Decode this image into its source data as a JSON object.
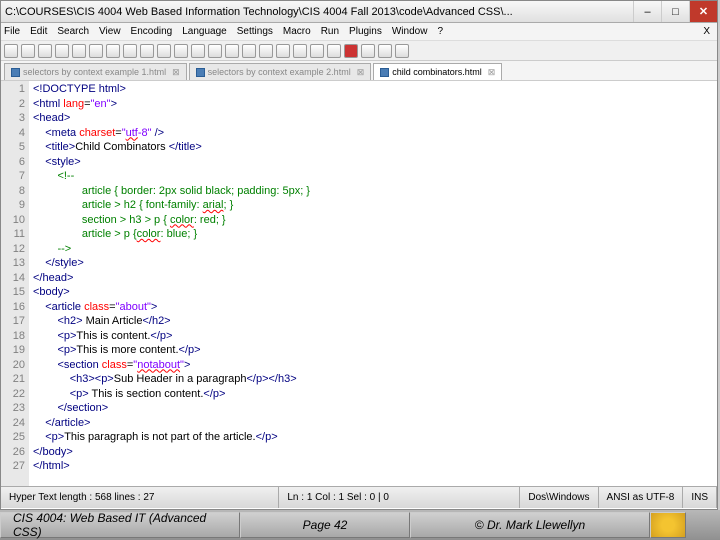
{
  "titlebar": {
    "path": "C:\\COURSES\\CIS 4004   Web Based Information Technology\\CIS 4004    Fall 2013\\code\\Advanced CSS\\..."
  },
  "menubar": [
    "File",
    "Edit",
    "Search",
    "View",
    "Encoding",
    "Language",
    "Settings",
    "Macro",
    "Run",
    "Plugins",
    "Window",
    "?"
  ],
  "tabs": [
    {
      "label": "selectors by context example 1.html",
      "active": false
    },
    {
      "label": "selectors by context example 2.html",
      "active": false
    },
    {
      "label": "child combinators.html",
      "active": true
    }
  ],
  "code": {
    "lines": [
      {
        "n": 1,
        "html": "<span class='tag'>&lt;!DOCTYPE html&gt;</span>"
      },
      {
        "n": 2,
        "html": "<span class='tag'>&lt;html</span> <span class='attr'>lang</span>=<span class='str'>\"en\"</span><span class='tag'>&gt;</span>"
      },
      {
        "n": 3,
        "html": "<span class='tag'>&lt;head&gt;</span>"
      },
      {
        "n": 4,
        "html": "    <span class='tag'>&lt;meta</span> <span class='attr'>charset</span>=<span class='str'>\"<span class='wavy'>utf</span>-8\"</span> <span class='tag'>/&gt;</span>"
      },
      {
        "n": 5,
        "html": "    <span class='tag'>&lt;title&gt;</span><span class='txt'>Child Combinators </span><span class='tag'>&lt;/title&gt;</span>"
      },
      {
        "n": 6,
        "html": "    <span class='tag'>&lt;style&gt;</span>"
      },
      {
        "n": 7,
        "html": "        <span class='com'>&lt;!--</span>"
      },
      {
        "n": 8,
        "html": "<span class='com'>                article { border: 2px solid black; padding: 5px; }</span>"
      },
      {
        "n": 9,
        "html": "<span class='com'>                article &gt; h2 { font-family: <span class='wavy'>arial</span>; }</span>"
      },
      {
        "n": 10,
        "html": "<span class='com'>                section &gt; h3 &gt; p { <span class='wavy'>color</span>: red; }</span>"
      },
      {
        "n": 11,
        "html": "<span class='com'>                article &gt; p {<span class='wavy'>color</span>: blue; }</span>"
      },
      {
        "n": 12,
        "html": "<span class='com'>        --&gt;</span>"
      },
      {
        "n": 13,
        "html": "    <span class='tag'>&lt;/style&gt;</span>"
      },
      {
        "n": 14,
        "html": "<span class='tag'>&lt;/head&gt;</span>"
      },
      {
        "n": 15,
        "html": "<span class='tag'>&lt;body&gt;</span>"
      },
      {
        "n": 16,
        "html": "    <span class='tag'>&lt;article</span> <span class='attr'>class</span>=<span class='str'>\"about\"</span><span class='tag'>&gt;</span>"
      },
      {
        "n": 17,
        "html": "        <span class='tag'>&lt;h2&gt;</span><span class='txt'> Main Article</span><span class='tag'>&lt;/h2&gt;</span>"
      },
      {
        "n": 18,
        "html": "        <span class='tag'>&lt;p&gt;</span><span class='txt'>This is content.</span><span class='tag'>&lt;/p&gt;</span>"
      },
      {
        "n": 19,
        "html": "        <span class='tag'>&lt;p&gt;</span><span class='txt'>This is more content.</span><span class='tag'>&lt;/p&gt;</span>"
      },
      {
        "n": 20,
        "html": "        <span class='tag'>&lt;section</span> <span class='attr'>class</span>=<span class='str'>\"<span class='wavy'>notabout</span>\"</span><span class='tag'>&gt;</span>"
      },
      {
        "n": 21,
        "html": "            <span class='tag'>&lt;h3&gt;&lt;p&gt;</span><span class='txt'>Sub Header in a paragraph</span><span class='tag'>&lt;/p&gt;&lt;/h3&gt;</span>"
      },
      {
        "n": 22,
        "html": "            <span class='tag'>&lt;p&gt;</span><span class='txt'> This is section content.</span><span class='tag'>&lt;/p&gt;</span>"
      },
      {
        "n": 23,
        "html": "        <span class='tag'>&lt;/section&gt;</span>"
      },
      {
        "n": 24,
        "html": "    <span class='tag'>&lt;/article&gt;</span>"
      },
      {
        "n": 25,
        "html": "    <span class='tag'>&lt;p&gt;</span><span class='txt'>This paragraph is not part of the article.</span><span class='tag'>&lt;/p&gt;</span>"
      },
      {
        "n": 26,
        "html": "<span class='tag'>&lt;/body&gt;</span>"
      },
      {
        "n": 27,
        "html": "<span class='tag'>&lt;/html&gt;</span>"
      }
    ]
  },
  "statusbar": {
    "left": "Hyper Text   length : 568    lines : 27",
    "pos": "Ln : 1    Col : 1    Sel : 0 | 0",
    "eol": "Dos\\Windows",
    "enc": "ANSI as UTF-8",
    "mode": "INS"
  },
  "footer": {
    "course": "CIS 4004: Web Based IT (Advanced CSS)",
    "page": "Page 42",
    "author": "© Dr. Mark Llewellyn"
  }
}
